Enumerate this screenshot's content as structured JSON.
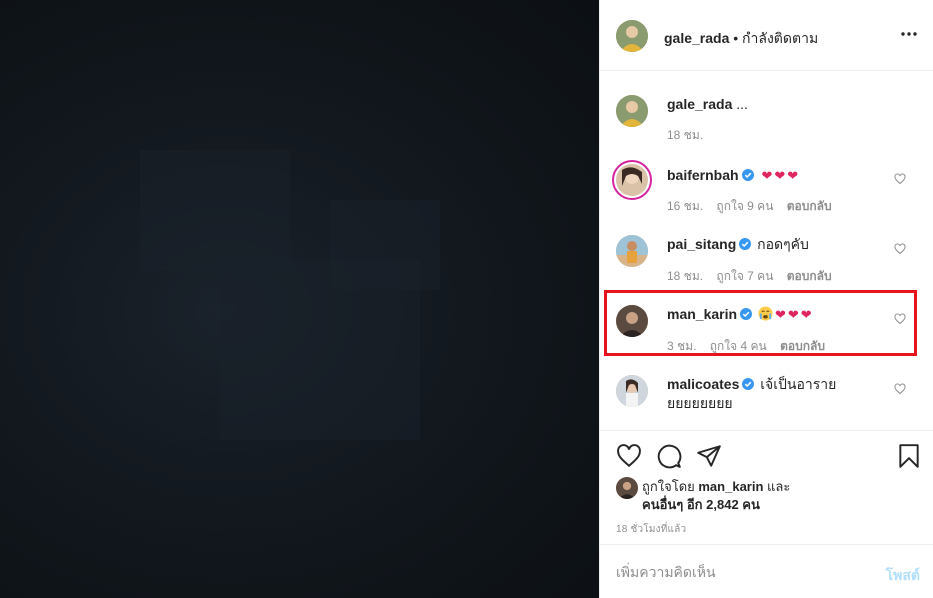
{
  "post": {
    "author": "gale_rada",
    "follow_status": "• กำลังติดตาม"
  },
  "caption": {
    "username": "gale_rada",
    "text": "...",
    "time": "18 ชม."
  },
  "comments": [
    {
      "username": "baifernbah",
      "verified": true,
      "text": "",
      "emoji": [
        "heart",
        "heart",
        "heart"
      ],
      "time": "16 ชม.",
      "likes": "ถูกใจ 9 คน",
      "reply": "ตอบกลับ"
    },
    {
      "username": "pai_sitang",
      "verified": true,
      "text": "กอดๆคับ",
      "emoji": [],
      "time": "18 ชม.",
      "likes": "ถูกใจ 7 คน",
      "reply": "ตอบกลับ"
    },
    {
      "username": "man_karin",
      "verified": true,
      "text": "",
      "emoji": [
        "crying-face",
        "heart",
        "heart",
        "heart"
      ],
      "time": "3 ชม.",
      "likes": "ถูกใจ 4 คน",
      "reply": "ตอบกลับ",
      "highlighted": true
    },
    {
      "username": "malicoates",
      "verified": true,
      "text": "เจ้เป็นอาราย",
      "text_line2": "ยยยยยยยย",
      "emoji": []
    }
  ],
  "liked_by": {
    "prefix": "ถูกใจโดย",
    "username": "man_karin",
    "conj": "และ",
    "others": "คนอื่นๆ อีก 2,842 คน"
  },
  "timestamp": "18 ชั่วโมงที่แล้ว",
  "comment_box": {
    "placeholder": "เพิ่มความคิดเห็น",
    "post_label": "โพสต์"
  },
  "icons": [
    "more-icon",
    "verified-badge-icon",
    "heart-icon",
    "comment-icon",
    "share-icon",
    "bookmark-icon"
  ],
  "colors": {
    "highlight": "#e8141d",
    "verified": "#3897f0",
    "link": "#b2dffc"
  }
}
